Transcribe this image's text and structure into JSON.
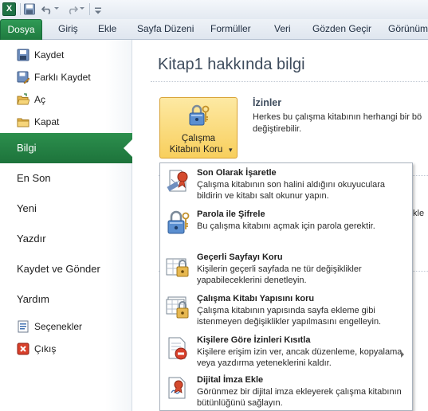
{
  "quick_access": {
    "app_icon": "excel-logo-icon",
    "app_letter": "X",
    "icons": [
      "save-icon",
      "undo-icon",
      "redo-icon",
      "customize-icon"
    ]
  },
  "tabs": [
    {
      "label": "Dosya",
      "active": true
    },
    {
      "label": "Giriş"
    },
    {
      "label": "Ekle"
    },
    {
      "label": "Sayfa Düzeni"
    },
    {
      "label": "Formüller"
    },
    {
      "label": "Veri"
    },
    {
      "label": "Gözden Geçir"
    },
    {
      "label": "Görünüm"
    }
  ],
  "nav": {
    "small_items": [
      {
        "label": "Kaydet",
        "icon": "save-icon"
      },
      {
        "label": "Farklı Kaydet",
        "icon": "save-as-icon"
      },
      {
        "label": "Aç",
        "icon": "open-folder-icon"
      },
      {
        "label": "Kapat",
        "icon": "close-folder-icon"
      }
    ],
    "big_items": [
      {
        "label": "Bilgi",
        "active": true
      },
      {
        "label": "En Son"
      },
      {
        "label": "Yeni"
      },
      {
        "label": "Yazdır"
      },
      {
        "label": "Kaydet ve Gönder"
      },
      {
        "label": "Yardım"
      }
    ],
    "bottom_items": [
      {
        "label": "Seçenekler",
        "icon": "options-icon"
      },
      {
        "label": "Çıkış",
        "icon": "exit-icon"
      }
    ]
  },
  "info": {
    "title": "Kitap1 hakkında bilgi",
    "protect_button": {
      "line1": "Çalışma",
      "line2": "Kitabını Koru",
      "caret": "▾"
    },
    "permissions": {
      "title": "İzinler",
      "desc_line1": "Herkes bu çalışma kitabının herhangi bir bö",
      "desc_line2": "değiştirebilir."
    },
    "background_fragment": "kle"
  },
  "protect_menu": [
    {
      "title": "Son Olarak İşaretle",
      "desc": "Çalışma kitabının son halini aldığını okuyuculara bildirin ve kitabı salt okunur yapın.",
      "icon": "mark-final-icon"
    },
    {
      "title": "Parola ile Şifrele",
      "desc": "Bu çalışma kitabını açmak için parola gerektir.",
      "icon": "encrypt-password-icon"
    },
    {
      "title": "Geçerli Sayfayı Koru",
      "desc": "Kişilerin geçerli sayfada ne tür değişiklikler yapabileceklerini denetleyin.",
      "icon": "protect-sheet-icon"
    },
    {
      "title": "Çalışma Kitabı Yapısını koru",
      "desc": "Çalışma kitabının yapısında sayfa ekleme gibi istenmeyen değişiklikler yapılmasını engelleyin.",
      "icon": "protect-structure-icon"
    },
    {
      "title": "Kişilere Göre İzinleri Kısıtla",
      "desc": "Kişilere erişim izin ver, ancak düzenleme, kopyalama veya yazdırma yeteneklerini kaldır.",
      "icon": "restrict-permission-icon",
      "submenu": true
    },
    {
      "title": "Dijital İmza Ekle",
      "desc": "Görünmez bir dijital imza ekleyerek çalışma kitabının bütünlüğünü sağlayın.",
      "icon": "digital-signature-icon"
    }
  ],
  "colors": {
    "accent": "#1f7a3f",
    "protect_button": "#f8cf5d",
    "title_text": "#3d4b5c"
  }
}
